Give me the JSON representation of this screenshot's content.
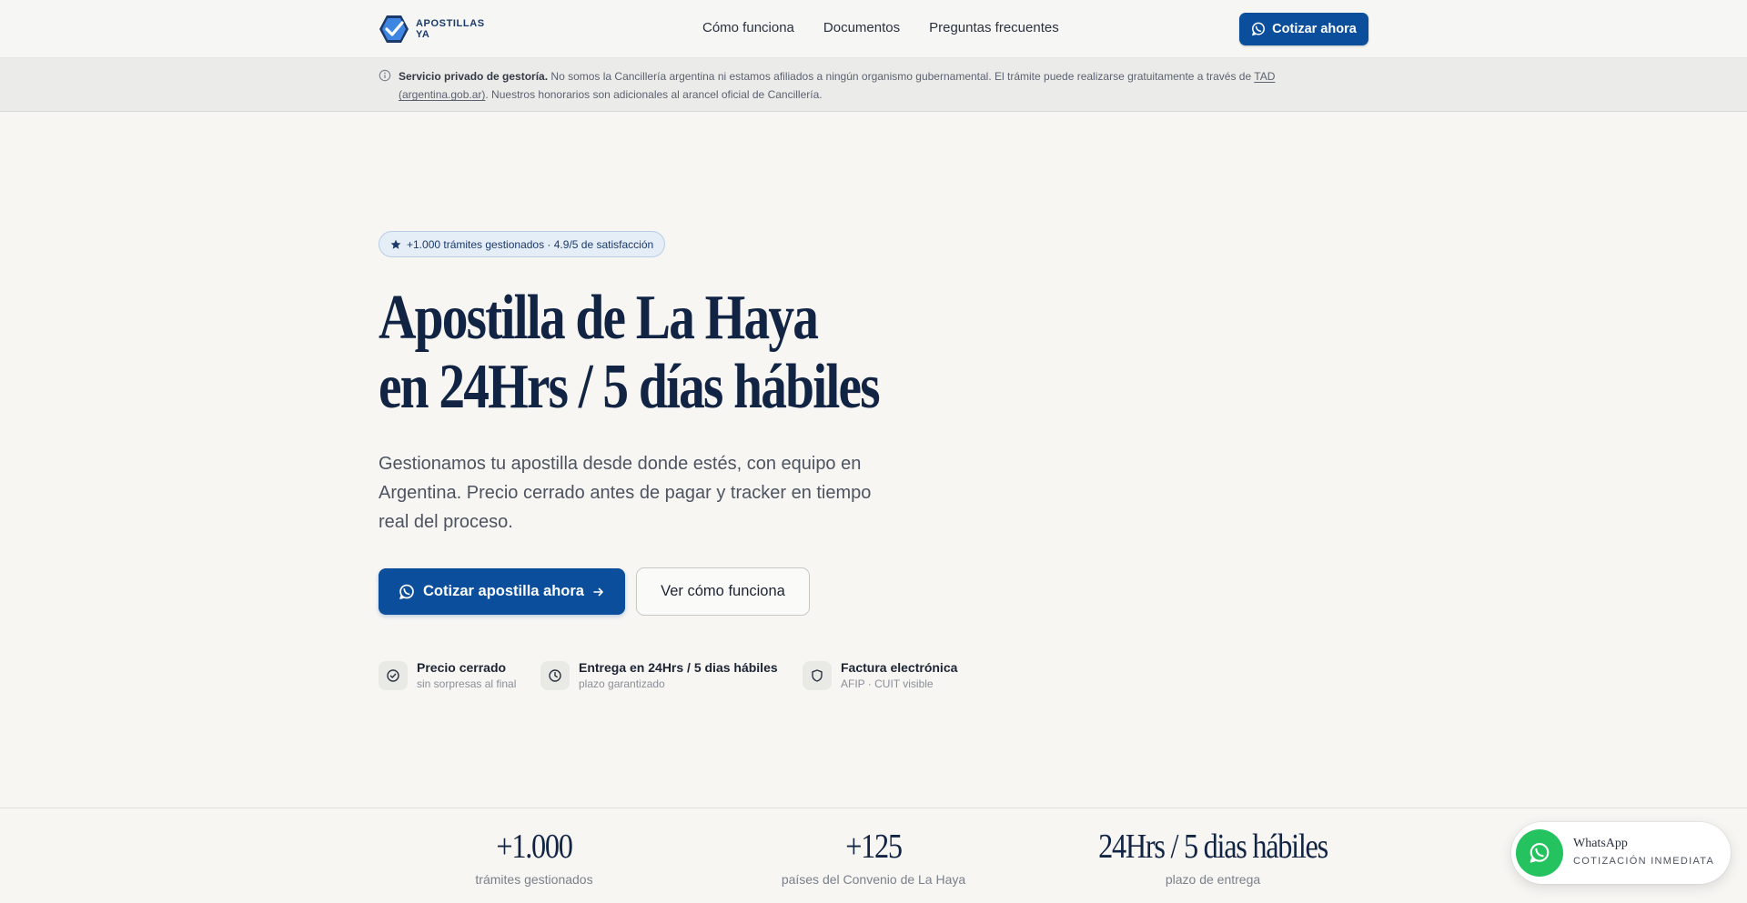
{
  "header": {
    "logo_line1": "APOSTILLAS",
    "logo_line2": "YA",
    "nav": [
      "Cómo funciona",
      "Documentos",
      "Preguntas frecuentes"
    ],
    "cta_label": "Cotizar ahora"
  },
  "notice": {
    "bold": "Servicio privado de gestoría.",
    "text_1": " No somos la Cancillería argentina ni estamos afiliados a ningún organismo gubernamental. El trámite puede realizarse gratuitamente a través de ",
    "link_1": "TAD",
    "link_2": "(argentina.gob.ar)",
    "text_2": ". Nuestros honorarios son adicionales al arancel oficial de Cancillería."
  },
  "hero": {
    "badge": "+1.000 trámites gestionados · 4.9/5 de satisfacción",
    "title_line1": "Apostilla de La Haya",
    "title_line2": "en 24Hrs / 5 días hábiles",
    "subtitle": "Gestionamos tu apostilla desde donde estés, con equipo en Argentina. Precio cerrado antes de pagar y tracker en tiempo real del proceso.",
    "primary_cta": "Cotizar apostilla ahora",
    "secondary_cta": "Ver cómo funciona",
    "features": [
      {
        "title": "Precio cerrado",
        "sub": "sin sorpresas al final",
        "icon": "check-circle-icon"
      },
      {
        "title": "Entrega en 24Hrs / 5 dias hábiles",
        "sub": "plazo garantizado",
        "icon": "clock-icon"
      },
      {
        "title": "Factura electrónica",
        "sub": "AFIP · CUIT visible",
        "icon": "shield-icon"
      }
    ]
  },
  "stats": [
    {
      "value": "+1.000",
      "label": "trámites gestionados"
    },
    {
      "value": "+125",
      "label": "países del Convenio de La Haya"
    },
    {
      "value": "24Hrs / 5 dias hábiles",
      "label": "plazo de entrega"
    }
  ],
  "whatsapp_float": {
    "title": "WhatsApp",
    "subtitle": "COTIZACIÓN INMEDIATA"
  },
  "colors": {
    "brand": "#0b4f9c",
    "navy": "#122444",
    "whatsapp": "#25c35f",
    "background": "#f7f6f3"
  }
}
